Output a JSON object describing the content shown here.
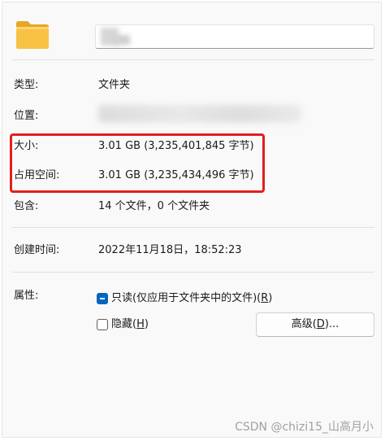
{
  "header": {
    "folder_icon": "folder-icon"
  },
  "properties": {
    "type_label": "类型:",
    "type_value": "文件夹",
    "location_label": "位置:",
    "size_label": "大小:",
    "size_value": "3.01 GB (3,235,401,845 字节)",
    "size_on_disk_label": "占用空间:",
    "size_on_disk_value": "3.01 GB (3,235,434,496 字节)",
    "contains_label": "包含:",
    "contains_value": "14 个文件，0 个文件夹",
    "created_label": "创建时间:",
    "created_value": "2022年11月18日，18:52:23",
    "attributes_label": "属性:"
  },
  "attributes": {
    "readonly_text": "只读(仅应用于文件夹中的文件)(",
    "readonly_key": "R",
    "readonly_tail": ")",
    "hidden_text": "隐藏(",
    "hidden_key": "H",
    "hidden_tail": ")",
    "advanced_text": "高级(",
    "advanced_key": "D",
    "advanced_tail": ")..."
  },
  "watermark": "CSDN @chizi15_山高月小",
  "colors": {
    "highlight": "#e0201b",
    "accent": "#0067c0",
    "folder": "#f8c245"
  }
}
